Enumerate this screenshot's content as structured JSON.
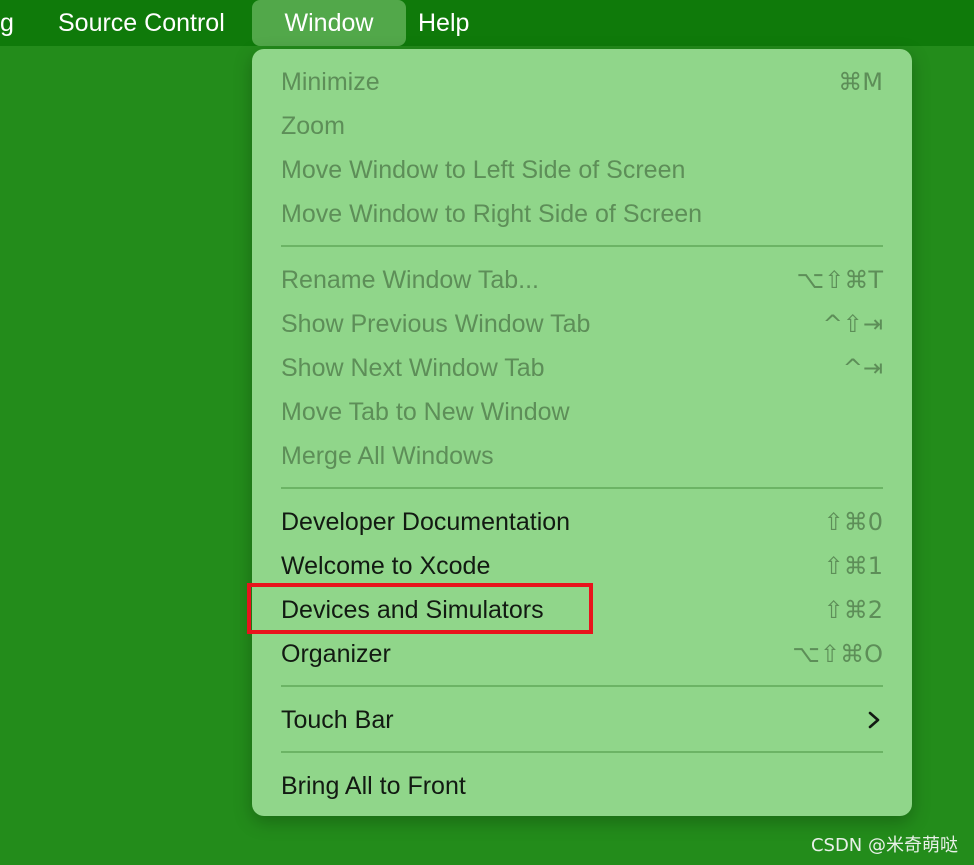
{
  "menubar": {
    "items": [
      {
        "label": "g"
      },
      {
        "label": "Source Control"
      },
      {
        "label": "Window"
      },
      {
        "label": "Help"
      }
    ]
  },
  "menu": {
    "items": [
      {
        "label": "Minimize",
        "shortcut": "⌘M"
      },
      {
        "label": "Zoom",
        "shortcut": ""
      },
      {
        "label": "Move Window to Left Side of Screen",
        "shortcut": ""
      },
      {
        "label": "Move Window to Right Side of Screen",
        "shortcut": ""
      },
      {
        "label": "Rename Window Tab...",
        "shortcut": "⌥⇧⌘T"
      },
      {
        "label": "Show Previous Window Tab",
        "shortcut": "^⇧⇥"
      },
      {
        "label": "Show Next Window Tab",
        "shortcut": "^⇥"
      },
      {
        "label": "Move Tab to New Window",
        "shortcut": ""
      },
      {
        "label": "Merge All Windows",
        "shortcut": ""
      },
      {
        "label": "Developer Documentation",
        "shortcut": "⇧⌘0"
      },
      {
        "label": "Welcome to Xcode",
        "shortcut": "⇧⌘1"
      },
      {
        "label": "Devices and Simulators",
        "shortcut": "⇧⌘2"
      },
      {
        "label": "Organizer",
        "shortcut": "⌥⇧⌘O"
      },
      {
        "label": "Touch Bar",
        "shortcut": ""
      },
      {
        "label": "Bring All to Front",
        "shortcut": ""
      }
    ]
  },
  "watermark": "CSDN @米奇萌哒",
  "colors": {
    "background": "#238c1b",
    "menubar": "#0f7a0a",
    "menu": "#90d68a",
    "highlight": "#e8141c"
  },
  "icons": {
    "submenu": "chevron-right-icon"
  }
}
